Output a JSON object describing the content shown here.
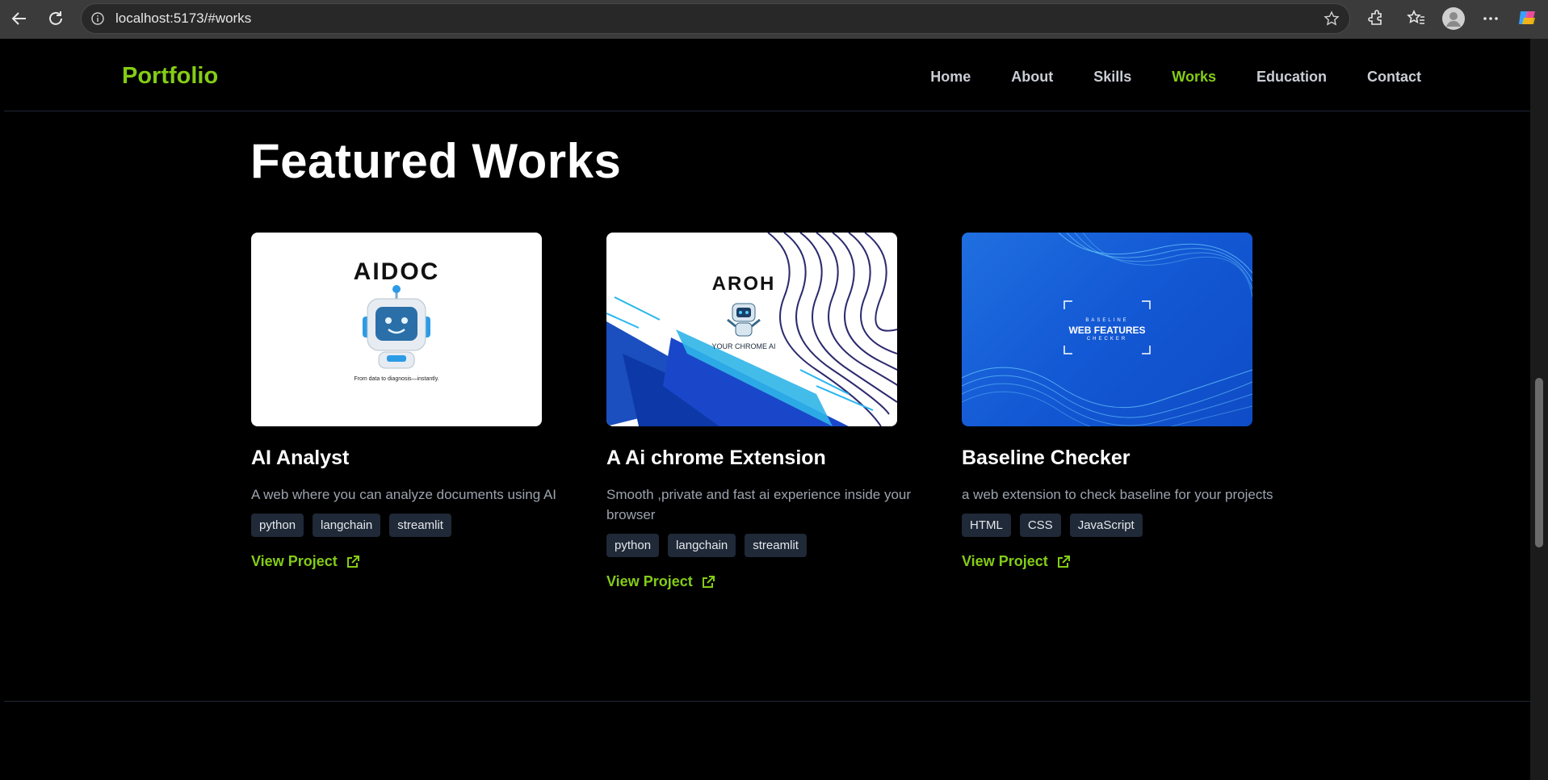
{
  "browser": {
    "url": "localhost:5173/#works",
    "progress": 0.55
  },
  "nav": {
    "brand": "Portfolio",
    "links": [
      "Home",
      "About",
      "Skills",
      "Works",
      "Education",
      "Contact"
    ],
    "active": "Works"
  },
  "section": {
    "title": "Featured Works"
  },
  "projects": [
    {
      "title": "AI Analyst",
      "description": "A web where you can analyze documents using AI",
      "tags": [
        "python",
        "langchain",
        "streamlit"
      ],
      "link_label": "View Project",
      "image": {
        "heading": "AIDOC",
        "caption": "From data to diagnosis—instantly."
      }
    },
    {
      "title": "A Ai chrome Extension",
      "description": "Smooth ,private and fast ai experience inside your browser",
      "tags": [
        "python",
        "langchain",
        "streamlit"
      ],
      "link_label": "View Project",
      "image": {
        "heading": "AROH",
        "caption": "YOUR CHROME AI"
      }
    },
    {
      "title": "Baseline Checker",
      "description": "a web extension to check baseline for your projects",
      "tags": [
        "HTML",
        "CSS",
        "JavaScript"
      ],
      "link_label": "View Project",
      "image": {
        "line1": "BASELINE",
        "line2": "WEB FEATURES",
        "line3": "CHECKER"
      }
    }
  ],
  "colors": {
    "accent": "#84cc16",
    "progress": "#22c55e",
    "tag_bg": "#1f2937"
  }
}
